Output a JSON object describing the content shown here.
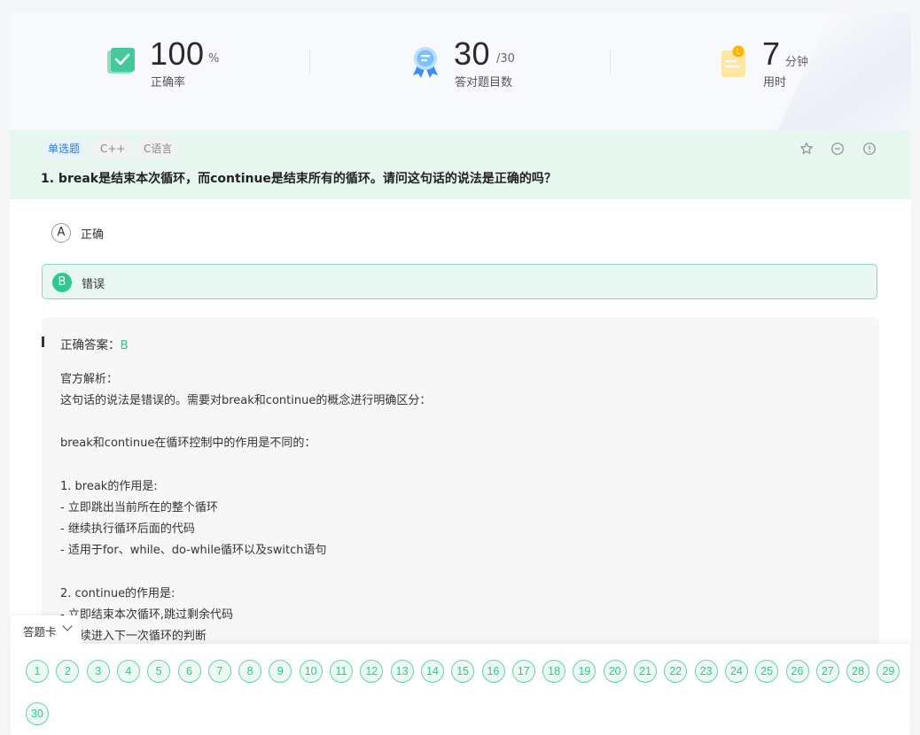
{
  "stats": {
    "accuracy": {
      "value": "100",
      "unit": "%",
      "label": "正确率",
      "icon": "check-book-icon"
    },
    "correct": {
      "value": "30",
      "unit": "/30",
      "label": "答对题目数",
      "icon": "medal-icon"
    },
    "time": {
      "value": "7",
      "unit": "分钟",
      "label": "用时",
      "icon": "clipboard-icon"
    }
  },
  "question": {
    "type_tag": "单选题",
    "tags": [
      "C++",
      "C语言"
    ],
    "title": "1. break是结束本次循环，而continue是结束所有的循环。请问这句话的说法是正确的吗？",
    "actions": [
      "star-icon",
      "minus-circle-icon",
      "info-circle-icon"
    ]
  },
  "options": [
    {
      "letter": "A",
      "text": "正确",
      "selected": false
    },
    {
      "letter": "B",
      "text": "错误",
      "selected": true
    }
  ],
  "analysis": {
    "answer_label": "正确答案：",
    "answer_value": "B",
    "lines": [
      "官方解析：",
      "这句话的说法是错误的。需要对break和continue的概念进行明确区分：",
      "",
      "break和continue在循环控制中的作用是不同的：",
      "",
      "1. break的作用是:",
      "- 立即跳出当前所在的整个循环",
      "- 继续执行循环后面的代码",
      "- 适用于for、while、do-while循环以及switch语句",
      "",
      "2. continue的作用是:",
      "- 立即结束本次循环,跳过剩余代码",
      "- 继续进入下一次循环的判断"
    ]
  },
  "answer_sheet": {
    "label": "答题卡",
    "numbers": [
      "1",
      "2",
      "3",
      "4",
      "5",
      "6",
      "7",
      "8",
      "9",
      "10",
      "11",
      "12",
      "13",
      "14",
      "15",
      "16",
      "17",
      "18",
      "19",
      "20",
      "21",
      "22",
      "23",
      "24",
      "25",
      "26",
      "27",
      "28",
      "29",
      "30"
    ]
  },
  "colors": {
    "accent": "#2dc990",
    "tag_blue": "#2f7bd6",
    "question_bg": "#e8f6f0"
  }
}
